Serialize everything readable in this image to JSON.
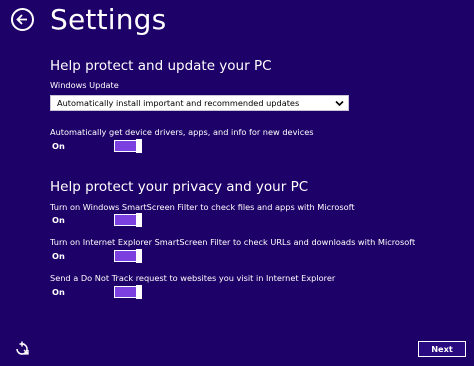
{
  "header": {
    "title": "Settings"
  },
  "sections": [
    {
      "heading": "Help protect and update your PC",
      "windows_update": {
        "label": "Windows Update",
        "selected": "Automatically install important and recommended updates"
      },
      "drivers": {
        "label": "Automatically get device drivers, apps, and info for new devices",
        "state": "On"
      }
    },
    {
      "heading": "Help protect your privacy and your PC",
      "settings": [
        {
          "label": "Turn on Windows SmartScreen Filter to check files and apps with Microsoft",
          "state": "On"
        },
        {
          "label": "Turn on Internet Explorer SmartScreen Filter to check URLs and downloads with Microsoft",
          "state": "On"
        },
        {
          "label": "Send a Do Not Track request to websites you visit in Internet Explorer",
          "state": "On"
        }
      ]
    }
  ],
  "footer": {
    "next_label": "Next",
    "ease_icon": "ease-of-access-icon"
  },
  "colors": {
    "background": "#1d0068",
    "toggle_fill": "#7c3fe0"
  }
}
